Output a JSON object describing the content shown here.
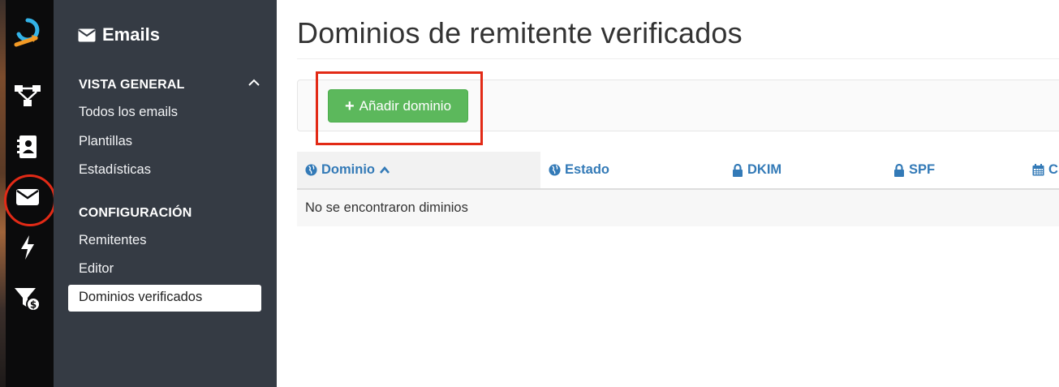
{
  "rail": {
    "items": [
      {
        "icon": "logo-icon"
      },
      {
        "icon": "workflow-icon"
      },
      {
        "icon": "contacts-icon"
      },
      {
        "icon": "envelope-icon",
        "active": true
      },
      {
        "icon": "bolt-icon"
      },
      {
        "icon": "funnel-dollar-icon"
      }
    ]
  },
  "sidebar": {
    "title": "Emails",
    "sections": [
      {
        "label": "VISTA GENERAL",
        "items": [
          "Todos los emails",
          "Plantillas",
          "Estadísticas"
        ]
      },
      {
        "label": "CONFIGURACIÓN",
        "items": [
          "Remitentes",
          "Editor",
          "Dominios verificados"
        ]
      }
    ],
    "active_item": "Dominios verificados"
  },
  "main": {
    "title": "Dominios de remitente verificados",
    "add_button": "Añadir dominio",
    "columns": [
      {
        "label": "Dominio",
        "icon": "globe-icon",
        "sorted": "asc"
      },
      {
        "label": "Estado",
        "icon": "globe-icon"
      },
      {
        "label": "DKIM",
        "icon": "lock-icon"
      },
      {
        "label": "SPF",
        "icon": "lock-icon"
      },
      {
        "label": "C",
        "icon": "calendar-icon"
      }
    ],
    "empty_message": "No se encontraron diminios"
  },
  "colors": {
    "rail_bg": "#0b0b0c",
    "sidebar_bg": "#353b44",
    "link_blue": "#337ab7",
    "success_green": "#5cb85c",
    "annotation_red": "#e22a16"
  }
}
